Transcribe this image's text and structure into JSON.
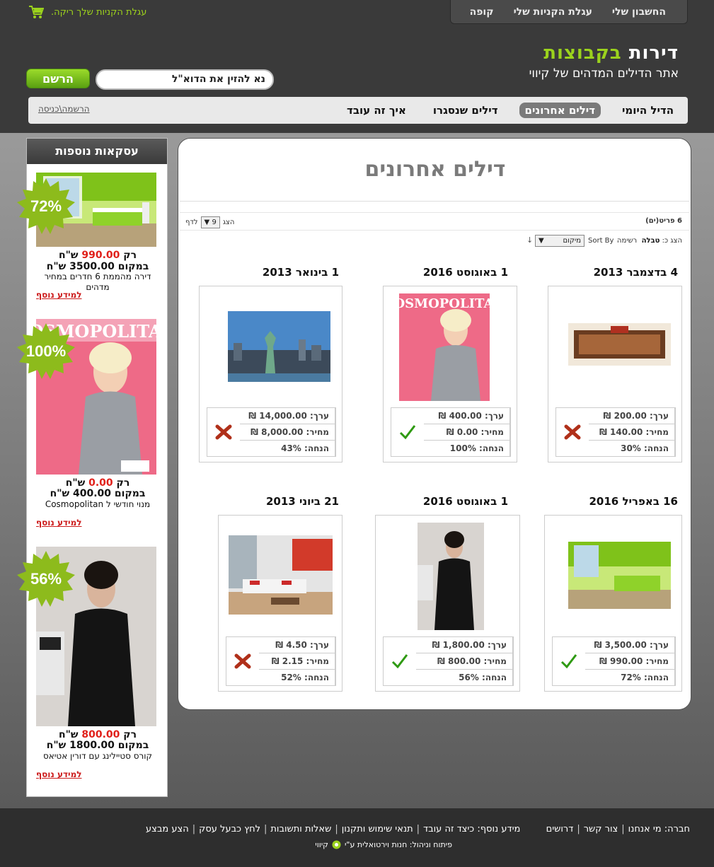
{
  "header": {
    "account_links": [
      "החשבון שלי",
      "עגלת הקניות שלי",
      "קופה"
    ],
    "cart_status": "עגלת הקניות שלך ריקה.",
    "logo_white": "דירות",
    "logo_green": "בקבוצות",
    "tagline": "אתר הדילים המדהים של קיווי",
    "email_placeholder": "נא להזין את הדוא\"ל",
    "register_label": "הרשם"
  },
  "nav": {
    "items": [
      "הדיל היומי",
      "דילים אחרונים",
      "דילים שנסגרו",
      "איך זה עובד"
    ],
    "login": "הרשמה\\כניסה"
  },
  "sidebar": {
    "title": "עסקאות נוספות",
    "deals": [
      {
        "discount": "72%",
        "price_prefix": "רק",
        "price": "990.00",
        "currency": "ש\"ח",
        "was": "במקום 3500.00 ש\"ח",
        "desc": "דירה מהממת 6 חדרים במחיר מדהים",
        "more": "למידע נוסף"
      },
      {
        "discount": "100%",
        "price_prefix": "רק",
        "price": "0.00",
        "currency": "ש\"ח",
        "was": "במקום 400.00 ש\"ח",
        "desc": "מנוי חודשי ל Cosmopolitan",
        "more": "למידע נוסף"
      },
      {
        "discount": "56%",
        "price_prefix": "רק",
        "price": "800.00",
        "currency": "ש\"ח",
        "was": "במקום 1800.00 ש\"ח",
        "desc": "קורס סטיילינג עם דורין אטיאס",
        "more": "למידע נוסף"
      }
    ]
  },
  "main": {
    "title": "דילים אחרונים",
    "count": "6 פריט(ים)",
    "per_page_label": "הצג",
    "per_page_value": "9",
    "per_page_suffix": "לדף",
    "view_label": "הצג כ:",
    "view_grid": "טבלה",
    "view_list": "רשימה",
    "sort_label": "Sort By",
    "sort_value": "מיקום",
    "sort_dir": "↓",
    "deals": [
      {
        "date": "4 בדצמבר 2013",
        "value": "ערך: 200.00 ₪",
        "price": "מחיר: 140.00 ₪",
        "discount": "הנחה: 30%",
        "status": "closed"
      },
      {
        "date": "1 באוגוסט 2016",
        "value": "ערך: 400.00 ₪",
        "price": "מחיר: 0.00 ₪",
        "discount": "הנחה: 100%",
        "status": "done"
      },
      {
        "date": "1 בינואר 2013",
        "value": "ערך: 14,000.00 ₪",
        "price": "מחיר: 8,000.00 ₪",
        "discount": "הנחה: 43%",
        "status": "closed"
      },
      {
        "date": "16 באפריל 2016",
        "value": "ערך: 3,500.00 ₪",
        "price": "מחיר: 990.00 ₪",
        "discount": "הנחה: 72%",
        "status": "done"
      },
      {
        "date": "1 באוגוסט 2016",
        "value": "ערך: 1,800.00 ₪",
        "price": "מחיר: 800.00 ₪",
        "discount": "הנחה: 56%",
        "status": "done"
      },
      {
        "date": "21 ביוני 2013",
        "value": "ערך: 4.50 ₪",
        "price": "מחיר: 2.15 ₪",
        "discount": "הנחה: 52%",
        "status": "closed"
      }
    ]
  },
  "footer": {
    "company_label": "חברה:",
    "company_links": [
      "מי אנחנו",
      "צור קשר",
      "דרושים"
    ],
    "info_label": "מידע נוסף:",
    "info_links": [
      "כיצד זה עובד",
      "תנאי שימוש ותקנון",
      "שאלות ותשובות",
      "לחץ כבעל עסק",
      "הצע מבצע"
    ],
    "credit": "פיתוח וניהול: חנות וירטואלית ע\"י",
    "credit_brand": "קיווי"
  },
  "colors": {
    "brand_green": "#9bd21d",
    "price_red": "#e0201a",
    "check_green": "#2e9a12",
    "cross_red": "#b0301a"
  }
}
